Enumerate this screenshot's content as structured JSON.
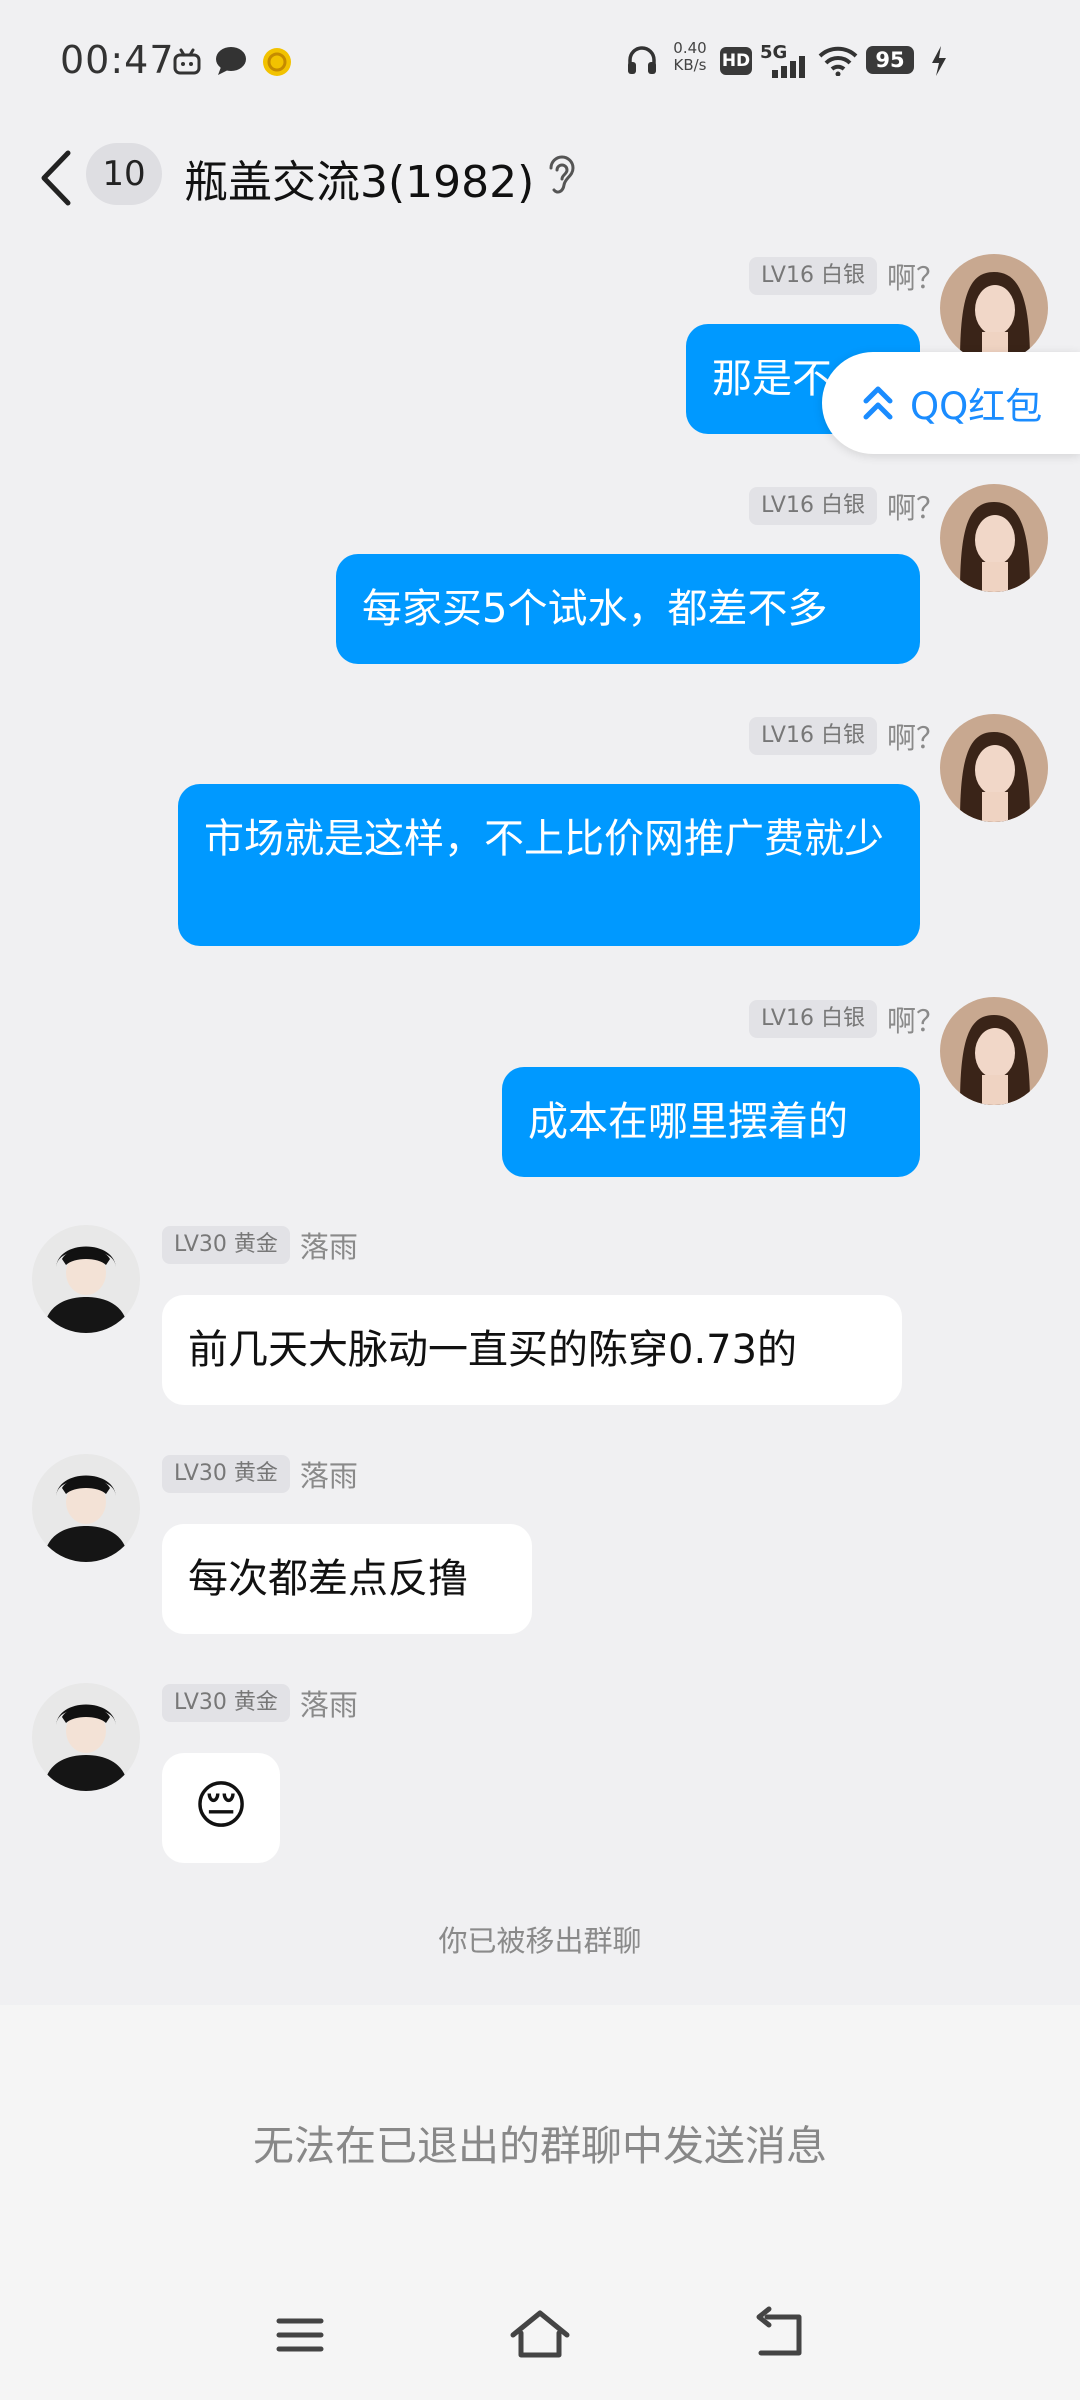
{
  "status_bar": {
    "time": "00:47",
    "net_speed_value": "0.40",
    "net_speed_unit": "KB/s",
    "hd_label": "HD",
    "network_label": "5G",
    "battery": "95",
    "icons": [
      "bilibili-icon",
      "message-bubble-icon",
      "coin-icon",
      "headphones-icon",
      "signal-icon",
      "wifi-icon",
      "charging-icon"
    ]
  },
  "header": {
    "unread_count": "10",
    "title": "瓶盖交流3(1982)"
  },
  "messages": [
    {
      "side": "right",
      "level": "LV16 白银",
      "nick": "啊？",
      "text": "那是不"
    },
    {
      "side": "right",
      "level": "LV16 白银",
      "nick": "啊？",
      "text": "每家买5个试水，都差不多"
    },
    {
      "side": "right",
      "level": "LV16 白银",
      "nick": "啊？",
      "text": "市场就是这样，不上比价网推广费就少"
    },
    {
      "side": "right",
      "level": "LV16 白银",
      "nick": "啊？",
      "text": "成本在哪里摆着的"
    },
    {
      "side": "left",
      "level": "LV30 黄金",
      "nick": "落雨",
      "text": "前几天大脉动一直买的陈穿0.73的"
    },
    {
      "side": "left",
      "level": "LV30 黄金",
      "nick": "落雨",
      "text": "每次都差点反撸"
    },
    {
      "side": "left",
      "level": "LV30 黄金",
      "nick": "落雨",
      "text": "😔"
    }
  ],
  "floating_pill": {
    "label": "QQ红包"
  },
  "system_notice": "你已被移出群聊",
  "bottom_notice": "无法在已退出的群聊中发送消息",
  "colors": {
    "bubble_out": "#0099ff",
    "bubble_in": "#ffffff",
    "background": "#f0f0f2",
    "accent": "#1a8cff"
  }
}
